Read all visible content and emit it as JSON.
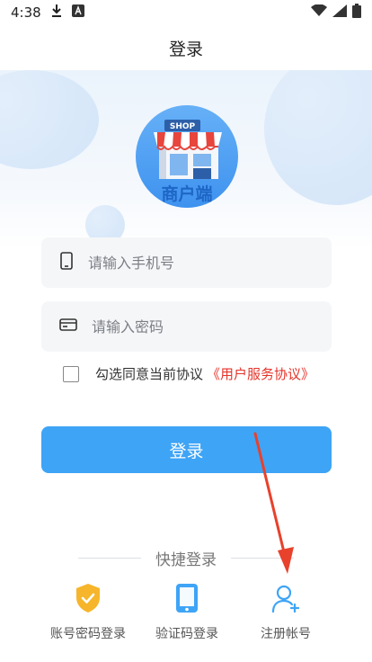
{
  "status_bar": {
    "time": "4:38"
  },
  "nav": {
    "title": "登录"
  },
  "logo": {
    "shop_sign": "SHOP",
    "caption": "商户端"
  },
  "form": {
    "phone_placeholder": "请输入手机号",
    "password_placeholder": "请输入密码",
    "agree_text": "勾选同意当前协议",
    "agreement_link": "《用户服务协议》",
    "login_button": "登录"
  },
  "quick_login": {
    "title": "快捷登录",
    "items": [
      {
        "label": "账号密码登录",
        "icon": "shield-check-icon"
      },
      {
        "label": "验证码登录",
        "icon": "phone-icon"
      },
      {
        "label": "注册帐号",
        "icon": "add-user-icon"
      }
    ]
  },
  "colors": {
    "primary": "#3ea4f6",
    "link": "#e5332a",
    "shield": "#f6b52a",
    "annotation_arrow": "#e8412c"
  }
}
